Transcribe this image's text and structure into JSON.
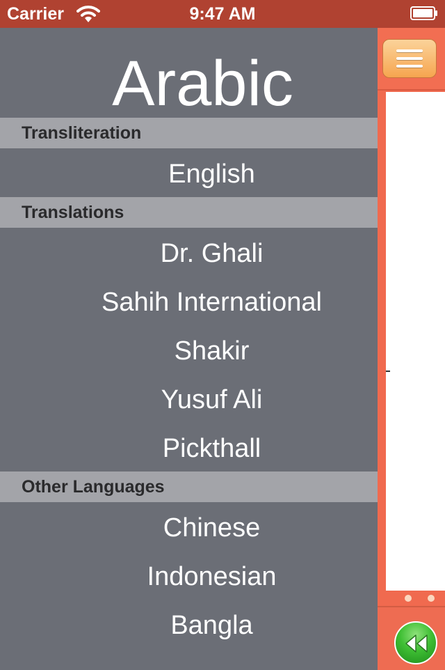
{
  "status_bar": {
    "carrier": "Carrier",
    "time": "9:47 AM",
    "wifi_icon": "wifi-icon",
    "battery_icon": "battery-icon"
  },
  "menu": {
    "title": "Arabic",
    "sections": [
      {
        "header": "Transliteration",
        "items": [
          "English"
        ]
      },
      {
        "header": "Translations",
        "items": [
          "Dr. Ghali",
          "Sahih International",
          "Shakir",
          "Yusuf Ali",
          "Pickthall"
        ]
      },
      {
        "header": "Other Languages",
        "items": [
          "Chinese",
          "Indonesian",
          "Bangla"
        ]
      }
    ]
  },
  "content": {
    "menu_button_icon": "hamburger-menu-icon",
    "rewind_button_icon": "rewind-icon"
  },
  "colors": {
    "status_bar": "#b04231",
    "menu_background": "#6b6e76",
    "section_header": "#a3a4a9",
    "accent": "#f06a4f",
    "rewind_green": "#3fbf34"
  }
}
